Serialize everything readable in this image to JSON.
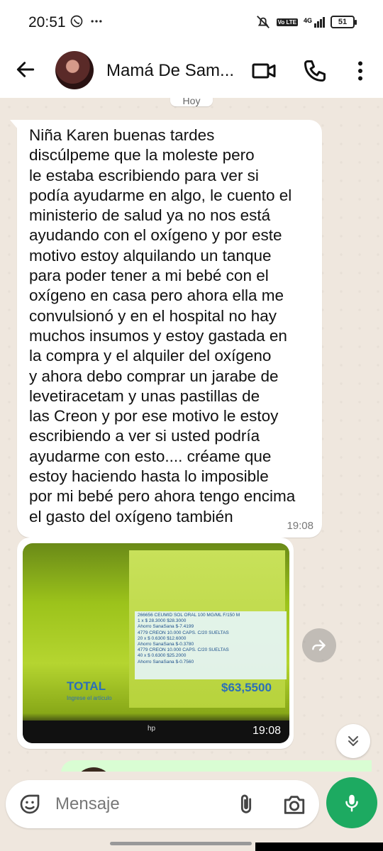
{
  "status_bar": {
    "time": "20:51",
    "left_icons": [
      "whatsapp-icon",
      "more-dots-icon"
    ],
    "right_icons": [
      "mute-icon",
      "volte-icon",
      "signal-4g-icon",
      "battery-icon"
    ],
    "network": "4G",
    "volte": "Vo LTE",
    "battery": "51"
  },
  "header": {
    "contact_name": "Mamá De Sam...",
    "icons": [
      "back-arrow-icon",
      "video-call-icon",
      "voice-call-icon",
      "menu-dots-icon"
    ]
  },
  "chat": {
    "date_chip": "Hoy",
    "messages": [
      {
        "type": "text",
        "direction": "incoming",
        "text": "Niña Karen buenas tardes\ndiscúlpeme que la moleste pero\nle estaba escribiendo para ver si\npodía ayudarme en algo, le cuento el\nministerio de salud ya no nos está\nayudando con el oxígeno y por este\nmotivo estoy alquilando un tanque\npara poder tener a mi bebé con el\noxígeno en casa pero ahora ella me\nconvulsionó y en el hospital no hay\nmuchos insumos y estoy gastada en\nla compra y el alquiler del oxígeno\ny ahora debo comprar un jarabe de\nlevetiracetam y unas pastillas de\nlas Creon y por ese motivo le estoy\nescribiendo a ver si usted podría\nayudarme con esto.... créame que\nestoy haciendo hasta lo imposible\npor mi bebé pero ahora tengo encima\nel gasto del oxígeno también",
        "time": "19:08"
      },
      {
        "type": "image",
        "direction": "incoming",
        "time": "19:08",
        "photo_content": {
          "receipt_lines": [
            "266656     CEUMID SOL ORAL 100 MG/ML F/150 M",
            "  1 x $ 28.3000                    $28.3000",
            "        Ahorro SanaSana            $-7.4199",
            "4779        CREON 10.000 CAPS. C/20 SUELTAS",
            "  20 x $ 0.6300                    $12.6000",
            "        Ahorro SanaSana            $-0.3780",
            "4779        CREON 10.000 CAPS. C/20 SUELTAS",
            "  40 x $ 0.6300                    $25.2000",
            "        Ahorro SanaSana            $-0.7560"
          ],
          "total_label": "TOTAL",
          "total_value": "$63,5500",
          "prompt": "Ingrese el artículo",
          "brand": "hp"
        }
      }
    ]
  },
  "input": {
    "placeholder": "Mensaje",
    "icons": [
      "emoji-icon",
      "attach-icon",
      "camera-icon",
      "mic-icon"
    ]
  },
  "colors": {
    "accent": "#1daa61",
    "chat_bg": "#efe7de",
    "bubble_in": "#ffffff",
    "bubble_out": "#d9fdd3"
  }
}
